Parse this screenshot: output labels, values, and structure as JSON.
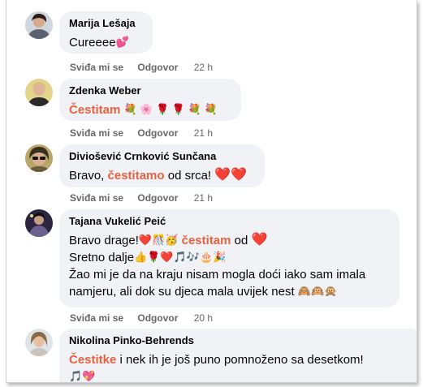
{
  "comments": [
    {
      "author": "Marija Lešaja",
      "text_plain": "Cureeee",
      "emojis": "💕",
      "actions": {
        "like": "Sviđa mi se",
        "reply": "Odgovor",
        "time": "22 h"
      }
    },
    {
      "author": "Zdenka Weber",
      "highlight": "Čestitam",
      "emojis": "💐 🌸 🌹 🌹 💐 💐",
      "actions": {
        "like": "Sviđa mi se",
        "reply": "Odgovor",
        "time": "21 h"
      }
    },
    {
      "author": "Diviošević Crnković Sunčana",
      "text_before": "Bravo,",
      "highlight": "čestitamo",
      "text_after": "od srca!",
      "emojis": "❤️❤️",
      "actions": {
        "like": "Sviđa mi se",
        "reply": "Odgovor",
        "time": "21 h"
      }
    },
    {
      "author": "Tajana Vukelić Peić",
      "line1_before": "Bravo drage!",
      "line1_emojis": "❤️🎊🥳",
      "highlight": "čestitam",
      "line1_after": "od",
      "line1_heart": "❤️",
      "line2_text": "Sretno dalje",
      "line2_emojis": "👍🌹❤️🎵🎶🎂🎉",
      "line3_text": "Žao mi je da na kraju nisam mogla doći iako sam imala",
      "line4_text": "namjeru, ali dok su djeca mala uvijek nest",
      "line4_emojis": "🙈🙉🙊",
      "actions": {
        "like": "Sviđa mi se",
        "reply": "Odgovor",
        "time": "20 h"
      }
    },
    {
      "author": "Nikolina Pinko-Behrends",
      "highlight": "Čestitke",
      "text_after": "i nek ih je još puno pomnoženo sa desetkom!",
      "line2_emojis": "🎵💖"
    }
  ],
  "colors": {
    "bubble_bg": "#f0f2f5",
    "highlight": "#e9603f",
    "meta_text": "#65676b",
    "heart": "#e41e3f"
  },
  "icons": [
    "profile-avatar",
    "heart-icon",
    "flower-emoji",
    "rose-emoji",
    "party-emoji",
    "monkey-emoji"
  ]
}
